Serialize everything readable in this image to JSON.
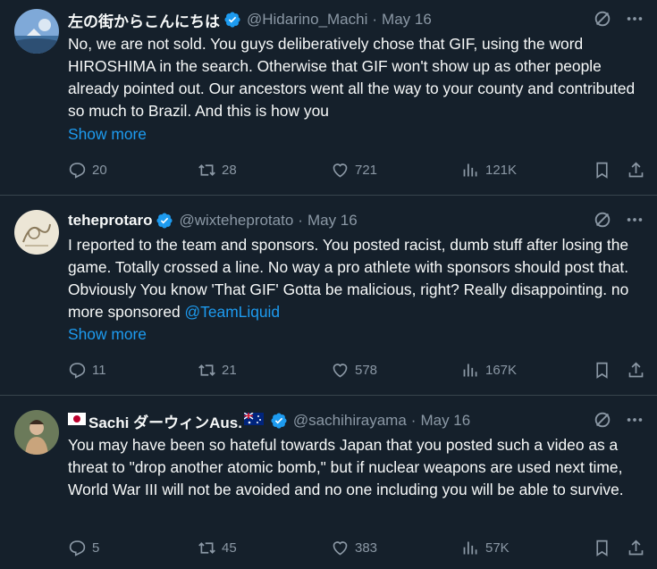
{
  "tweets": [
    {
      "display_name": "左の街からこんにちは",
      "handle": "@Hidarino_Machi",
      "date": "May 16",
      "text": "No, we are not sold.  You guys deliberatively chose that GIF, using the word HIROSHIMA in the search.  Otherwise that GIF won't show up as other people already pointed out.  Our ancestors went all the way to your county and contributed so much to Brazil.  And this is how you",
      "mention": "",
      "show_more": "Show more",
      "replies": "20",
      "retweets": "28",
      "likes": "721",
      "views": "121K"
    },
    {
      "display_name": "teheprotaro",
      "handle": "@wixteheprotato",
      "date": "May 16",
      "text": "I reported to the team and sponsors. You posted racist, dumb stuff after losing the game. Totally crossed a line. No way a pro athlete with sponsors should post that. Obviously You know 'That GIF' Gotta be malicious, right? Really disappointing. no more sponsored ",
      "mention": "@TeamLiquid",
      "show_more": "Show more",
      "replies": "11",
      "retweets": "21",
      "likes": "578",
      "views": "167K"
    },
    {
      "display_name": "Sachi ダーウィンAus.",
      "handle": "@sachihirayama",
      "date": "May 16",
      "text": "You may have been so hateful towards Japan that you posted such a video as a threat to \"drop another atomic bomb,\" but if nuclear weapons are used next time, World War III will not be avoided and no one including you will be able to survive.",
      "mention": "",
      "show_more": "",
      "replies": "5",
      "retweets": "45",
      "likes": "383",
      "views": "57K"
    }
  ],
  "separator": "·",
  "colors": {
    "background": "#15202b",
    "text": "#f7f9f9",
    "muted": "#8b98a5",
    "accent": "#1d9bf0",
    "border": "#38444d"
  },
  "icons": [
    "verified-badge-icon",
    "grok-icon",
    "more-icon",
    "reply-icon",
    "retweet-icon",
    "like-icon",
    "views-icon",
    "bookmark-icon",
    "share-icon"
  ]
}
